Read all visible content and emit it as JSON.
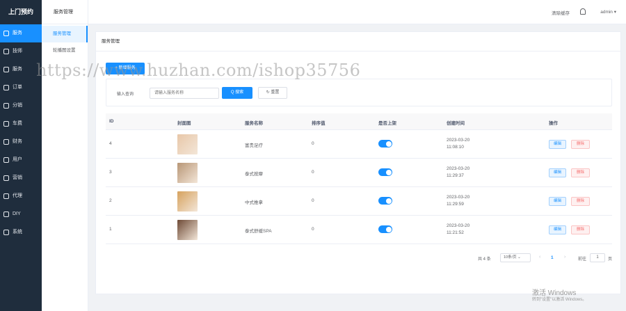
{
  "app": {
    "logo": "上门预约"
  },
  "nav": [
    {
      "label": "服务",
      "icon": "grid-icon",
      "active": true
    },
    {
      "label": "技师",
      "icon": "user-icon",
      "active": false
    },
    {
      "label": "服务",
      "icon": "image-icon",
      "active": false
    },
    {
      "label": "订单",
      "icon": "order-icon",
      "active": false
    },
    {
      "label": "分销",
      "icon": "team-icon",
      "active": false
    },
    {
      "label": "车费",
      "icon": "car-icon",
      "active": false
    },
    {
      "label": "财务",
      "icon": "wallet-icon",
      "active": false
    },
    {
      "label": "用户",
      "icon": "people-icon",
      "active": false
    },
    {
      "label": "营销",
      "icon": "bell-icon",
      "active": false
    },
    {
      "label": "代理",
      "icon": "agent-icon",
      "active": false
    },
    {
      "label": "DIY",
      "icon": "diy-icon",
      "active": false
    },
    {
      "label": "系统",
      "icon": "gear-icon",
      "active": false
    }
  ],
  "submenu": {
    "title": "服务管理",
    "items": [
      {
        "label": "服务管理",
        "active": true
      },
      {
        "label": "轮播图设置",
        "active": false
      }
    ]
  },
  "header": {
    "clear_cache": "清除缓存",
    "user": "admin ▾"
  },
  "card": {
    "title": "服务管理",
    "add_button": "+ 新增服务"
  },
  "search": {
    "label": "输入查询",
    "placeholder": "请输入服务名称",
    "search_button": "Q 搜索",
    "reset_button": "↻ 重置"
  },
  "table": {
    "columns": [
      "ID",
      "封面图",
      "服务名称",
      "排序值",
      "是否上架",
      "创建时间",
      "操作"
    ],
    "rows": [
      {
        "id": "4",
        "name": "富贵足疗",
        "sort": "0",
        "on_sale": true,
        "date": "2023-03-20",
        "time": "11:08:10",
        "img_color": "#e8c7a8"
      },
      {
        "id": "3",
        "name": "泰式按摩",
        "sort": "0",
        "on_sale": true,
        "date": "2023-03-20",
        "time": "11:29:37",
        "img_color": "#b89676"
      },
      {
        "id": "2",
        "name": "中式推拿",
        "sort": "0",
        "on_sale": true,
        "date": "2023-03-20",
        "time": "11:29:59",
        "img_color": "#d6a25e"
      },
      {
        "id": "1",
        "name": "泰式舒缓SPA",
        "sort": "0",
        "on_sale": true,
        "date": "2023-03-20",
        "time": "11:21:52",
        "img_color": "#6e4a36"
      }
    ],
    "edit_label": "编辑",
    "delete_label": "删除"
  },
  "pagination": {
    "total": "共 4 条",
    "page_size": "10条/页 ⌄",
    "prev": "‹",
    "current": "1",
    "next": "›",
    "goto": "前往",
    "goto_value": "1",
    "page_suffix": "页"
  },
  "watermark": {
    "text": "https://www.huzhan.com/ishop35756",
    "win_line1": "激活 Windows",
    "win_line2": "转到\"设置\"以激活 Windows。"
  },
  "colors": {
    "primary": "#1890ff",
    "sidebar": "#1f2d3d",
    "danger": "#f56c6c"
  }
}
